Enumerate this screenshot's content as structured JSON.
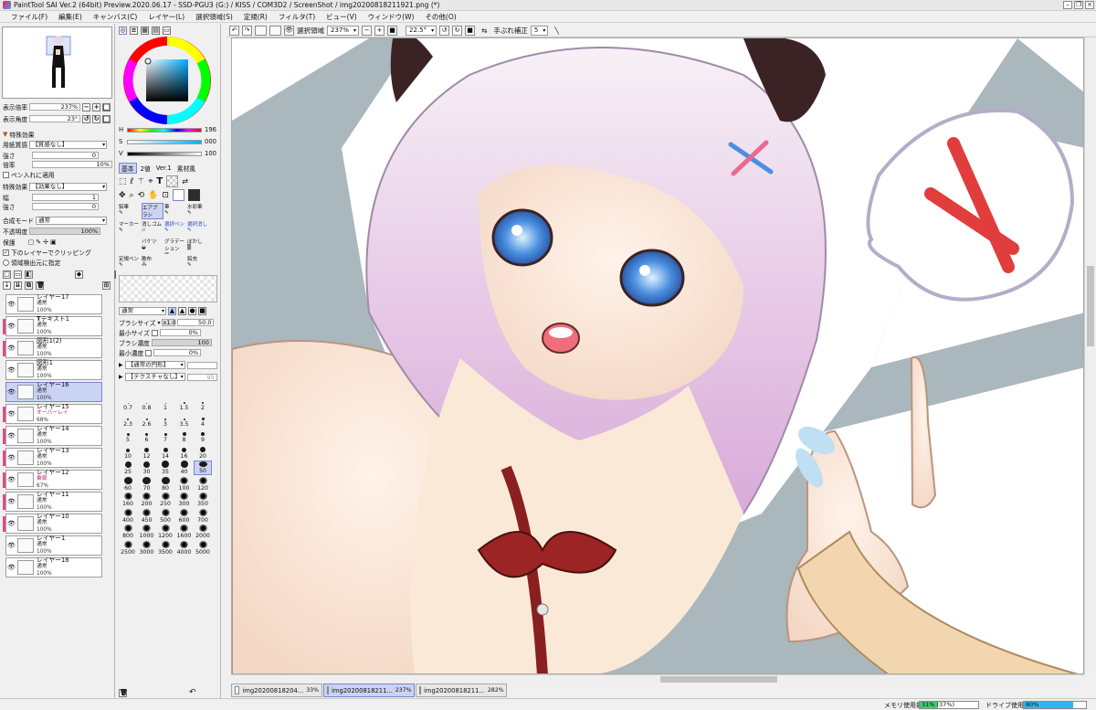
{
  "window": {
    "title": "PaintTool SAI Ver.2 (64bit) Preview.2020.06.17 - SSD-PGU3 (G:) / KISS / COM3D2 / ScreenShot / img20200818211921.png (*)"
  },
  "menu": [
    "ファイル(F)",
    "編集(E)",
    "キャンバス(C)",
    "レイヤー(L)",
    "選択領域(S)",
    "定規(R)",
    "フィルタ(T)",
    "ビュー(V)",
    "ウィンドウ(W)",
    "その他(O)"
  ],
  "navigator": {
    "zoom_label": "表示倍率",
    "zoom_value": "237%",
    "angle_label": "表示角度",
    "angle_value": "23°"
  },
  "effects": {
    "header": "特殊効果",
    "paper_label": "用紙質感",
    "paper_value": "【質感なし】",
    "strength_label": "強さ",
    "strength_value": "0",
    "scale_label": "倍率",
    "scale_value": "10%",
    "pen_apply": "ペン入れに適用",
    "effect_label": "特殊効果",
    "effect_value": "【効果なし】",
    "width_label": "幅",
    "width_value": "1",
    "strength2_label": "強さ",
    "strength2_value": "0"
  },
  "layer_props": {
    "blend_label": "合成モード",
    "blend_value": "通常",
    "opacity_label": "不透明度",
    "opacity_value": "100%",
    "protect_label": "保護",
    "clip_label": "下のレイヤーでクリッピング",
    "select_source_label": "領域検出元に指定"
  },
  "layers": [
    {
      "name": "レイヤー17",
      "mode": "通常",
      "opacity": "100%",
      "tag": false,
      "selected": false
    },
    {
      "name": "テキスト1",
      "mode": "通常",
      "opacity": "100%",
      "tag": true,
      "selected": false
    },
    {
      "name": "図形1(2)",
      "mode": "通常",
      "opacity": "100%",
      "tag": true,
      "selected": false
    },
    {
      "name": "図形1",
      "mode": "通常",
      "opacity": "100%",
      "tag": false,
      "selected": false
    },
    {
      "name": "レイヤー16",
      "mode": "通常",
      "opacity": "100%",
      "tag": false,
      "selected": true
    },
    {
      "name": "レイヤー15",
      "mode": "オーバーレイ",
      "opacity": "68%",
      "tag": true,
      "selected": false
    },
    {
      "name": "レイヤー14",
      "mode": "通常",
      "opacity": "100%",
      "tag": true,
      "selected": false
    },
    {
      "name": "レイヤー13",
      "mode": "通常",
      "opacity": "100%",
      "tag": true,
      "selected": false
    },
    {
      "name": "レイヤー12",
      "mode": "乗算",
      "opacity": "67%",
      "tag": true,
      "selected": false
    },
    {
      "name": "レイヤー11",
      "mode": "通常",
      "opacity": "100%",
      "tag": true,
      "selected": false
    },
    {
      "name": "レイヤー10",
      "mode": "通常",
      "opacity": "100%",
      "tag": true,
      "selected": false
    },
    {
      "name": "レイヤー1",
      "mode": "通常",
      "opacity": "100%",
      "tag": false,
      "selected": false
    },
    {
      "name": "レイヤー18",
      "mode": "通常",
      "opacity": "100%",
      "tag": false,
      "selected": false
    }
  ],
  "color": {
    "h_label": "H",
    "h_value": "196",
    "s_label": "S",
    "s_value": "000",
    "v_label": "V",
    "v_value": "100",
    "tabs": [
      "基本",
      "2値",
      "Ver.1",
      "素材風"
    ]
  },
  "tools": {
    "rows": [
      [
        "鉛筆",
        "エアブラシ",
        "筆",
        "水彩筆"
      ],
      [
        "マーカー",
        "消しゴム",
        "選択ペン",
        "選択消し"
      ],
      [
        "",
        "バケツ",
        "グラデーション",
        "ぼかし"
      ],
      [
        "定規ペン",
        "散布",
        "",
        "鉛充"
      ]
    ]
  },
  "brush": {
    "shape_value": "通常",
    "size_label": "ブラシサイズ",
    "size_mult": "x1.0",
    "size_value": "50.0",
    "min_size_label": "最小サイズ",
    "min_size_value": "0%",
    "density_label": "ブラシ濃度",
    "density_value": "100",
    "min_density_label": "最小濃度",
    "min_density_value": "0%",
    "edge_value": "【通常の円形】",
    "texture_value": "【テクスチャなし】",
    "texture_num": "95",
    "sizes": [
      "0.7",
      "0.8",
      "1",
      "1.5",
      "2",
      "2.3",
      "2.6",
      "3",
      "3.5",
      "4",
      "5",
      "6",
      "7",
      "8",
      "9",
      "10",
      "12",
      "14",
      "16",
      "20",
      "25",
      "30",
      "35",
      "40",
      "50",
      "60",
      "70",
      "80",
      "100",
      "120",
      "160",
      "200",
      "250",
      "300",
      "350",
      "400",
      "450",
      "500",
      "600",
      "700",
      "800",
      "1000",
      "1200",
      "1600",
      "2000",
      "2500",
      "3000",
      "3500",
      "4000",
      "5000"
    ],
    "selected_size": "50"
  },
  "toolbar": {
    "selection_label": "選択領域",
    "zoom_value": "237%",
    "angle_value": "22.5°",
    "stabilizer_label": "手ぶれ補正",
    "stabilizer_value": "5"
  },
  "doc_tabs": [
    {
      "name": "img20200818204...",
      "zoom": "33%",
      "active": false
    },
    {
      "name": "img20200818211...",
      "zoom": "237%",
      "active": true
    },
    {
      "name": "img20200818211...",
      "zoom": "282%",
      "active": false
    }
  ],
  "status": {
    "mem_label": "メモリ使用量",
    "mem_value": "31% (37%)",
    "mem_fraction": 0.31,
    "drive_label": "ドライブ使用量",
    "drive_value": "80%",
    "drive_fraction": 0.8
  },
  "colors": {
    "accent": "#7a86cc",
    "selection": "#cbd3f4",
    "layer_tag": "#e34a8a",
    "primary_color": "#2c2c2c"
  }
}
